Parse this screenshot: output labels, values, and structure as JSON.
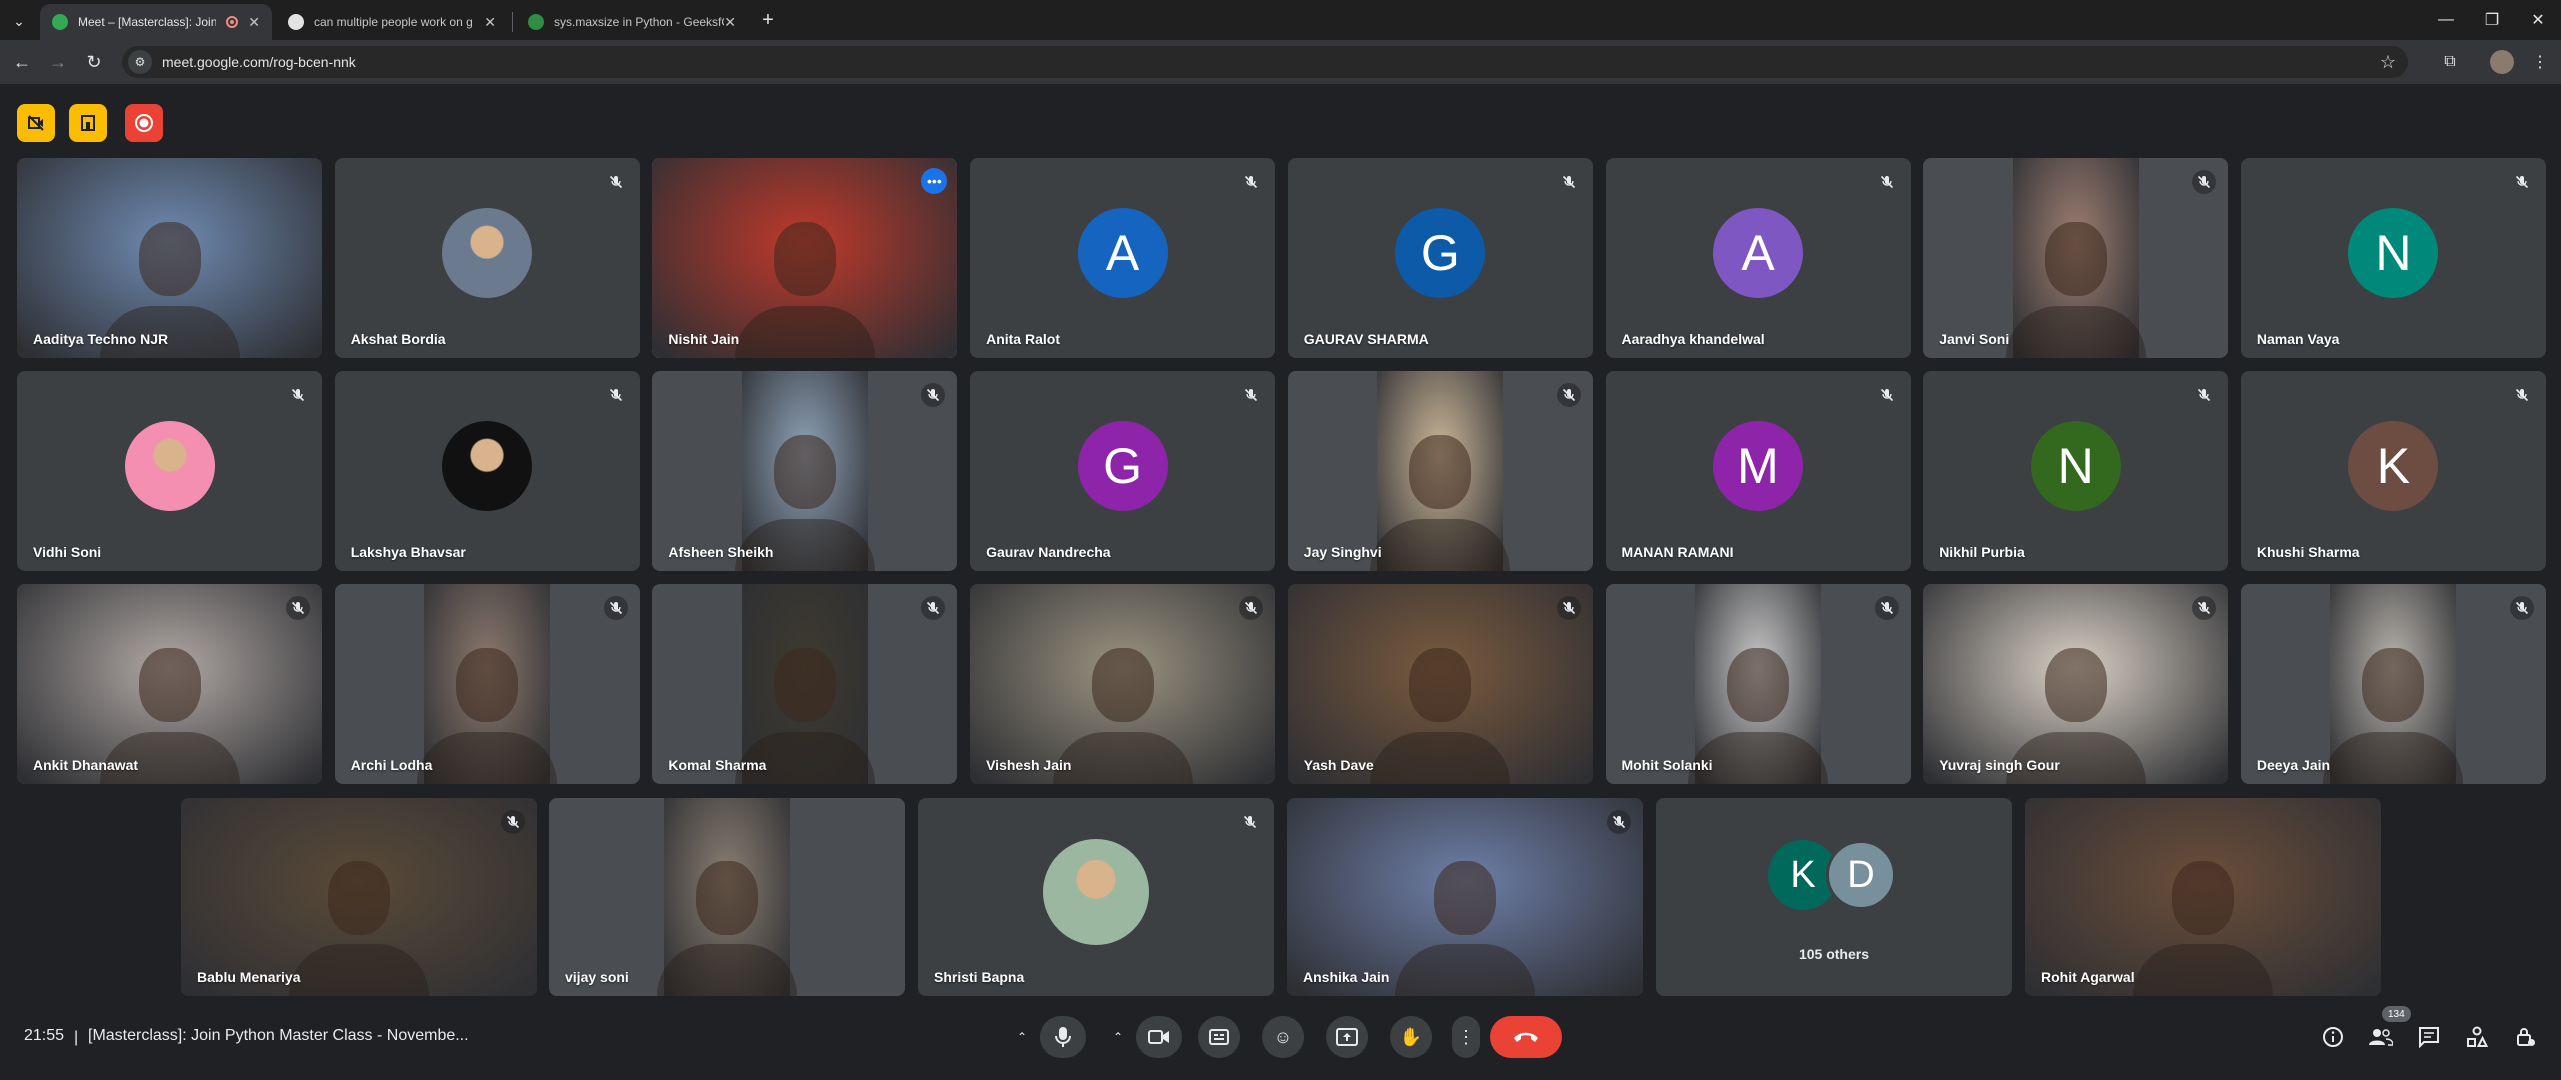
{
  "browser": {
    "tabs": [
      {
        "title": "Meet – [Masterclass]: Join P",
        "active": true,
        "favicon_color": "#34a853"
      },
      {
        "title": "can multiple people work on g",
        "active": false,
        "favicon_color": "#e3e3e3"
      },
      {
        "title": "sys.maxsize in Python - GeeksfG",
        "active": false,
        "favicon_color": "#2f8d46"
      }
    ],
    "url": "meet.google.com/rog-bcen-nnk"
  },
  "meet": {
    "colors": {
      "background": "#202124",
      "tile": "#3c4043",
      "speaker_ring": "#8ab4f8",
      "hangup": "#ea4335",
      "badge_yellow": "#fbbc04",
      "badge_red": "#ea4335"
    },
    "top_badges": [
      "no-video-warning-icon",
      "host-controls-icon",
      "recording-icon"
    ],
    "participants": [
      {
        "name": "Aaditya Techno NJR",
        "kind": "video",
        "muted": false,
        "video_tone": "#6f8bb2"
      },
      {
        "name": "Akshat Bordia",
        "kind": "photo",
        "muted": true,
        "avatar_color": "#6b7a8f"
      },
      {
        "name": "Nishit Jain",
        "kind": "video",
        "muted": false,
        "speaking": true,
        "video_tone": "#c0392b"
      },
      {
        "name": "Anita Ralot",
        "kind": "initial",
        "initial": "A",
        "muted": true,
        "avatar_color": "#1565c0"
      },
      {
        "name": "GAURAV SHARMA",
        "kind": "initial",
        "initial": "G",
        "muted": true,
        "avatar_color": "#0d5ba8"
      },
      {
        "name": "Aaradhya khandelwal",
        "kind": "initial",
        "initial": "A",
        "muted": true,
        "avatar_color": "#7e57c2"
      },
      {
        "name": "Janvi Soni",
        "kind": "video",
        "muted": true,
        "video_tone": "#9e7f72"
      },
      {
        "name": "Naman Vaya",
        "kind": "initial",
        "initial": "N",
        "muted": true,
        "avatar_color": "#00897b"
      },
      {
        "name": "Vidhi Soni",
        "kind": "photo",
        "muted": true,
        "avatar_color": "#f48fb1"
      },
      {
        "name": "Lakshya Bhavsar",
        "kind": "photo",
        "muted": true,
        "avatar_color": "#111111"
      },
      {
        "name": "Afsheen Sheikh",
        "kind": "video",
        "muted": true,
        "video_tone": "#8fa3b8"
      },
      {
        "name": "Gaurav Nandrecha",
        "kind": "initial",
        "initial": "G",
        "muted": true,
        "avatar_color": "#8e24aa"
      },
      {
        "name": "Jay Singhvi",
        "kind": "video",
        "muted": true,
        "video_tone": "#cdb899"
      },
      {
        "name": "MANAN RAMANI",
        "kind": "initial",
        "initial": "M",
        "muted": true,
        "avatar_color": "#8e24aa"
      },
      {
        "name": "Nikhil Purbia",
        "kind": "initial",
        "initial": "N",
        "muted": true,
        "avatar_color": "#33691e"
      },
      {
        "name": "Khushi Sharma",
        "kind": "initial",
        "initial": "K",
        "muted": true,
        "avatar_color": "#6d4c41"
      },
      {
        "name": "Ankit Dhanawat",
        "kind": "video",
        "muted": true,
        "video_tone": "#b0a8a4"
      },
      {
        "name": "Archi Lodha",
        "kind": "video",
        "muted": true,
        "video_tone": "#8d7a6e"
      },
      {
        "name": "Komal Sharma",
        "kind": "video",
        "muted": true,
        "video_tone": "#3e3a2f"
      },
      {
        "name": "Vishesh Jain",
        "kind": "video",
        "muted": true,
        "video_tone": "#9a9380"
      },
      {
        "name": "Yash Dave",
        "kind": "video",
        "muted": true,
        "video_tone": "#7a5a3e"
      },
      {
        "name": "Mohit Solanki",
        "kind": "video",
        "muted": true,
        "video_tone": "#c9c9c9"
      },
      {
        "name": "Yuvraj singh Gour",
        "kind": "video",
        "muted": true,
        "video_tone": "#d8d0c4"
      },
      {
        "name": "Deeya Jain",
        "kind": "video",
        "muted": true,
        "video_tone": "#b9b4ad"
      },
      {
        "name": "Bablu Menariya",
        "kind": "video",
        "muted": true,
        "video_tone": "#5a4a38"
      },
      {
        "name": "vijay soni",
        "kind": "video",
        "muted": false,
        "video_tone": "#8a7f72"
      },
      {
        "name": "Shristi Bapna",
        "kind": "photo",
        "muted": true,
        "avatar_color": "#9bb7a0"
      },
      {
        "name": "Anshika Jain",
        "kind": "video",
        "muted": true,
        "video_tone": "#6e7fa8"
      },
      {
        "name": "Rohit Agarwal",
        "kind": "video",
        "muted": false,
        "video_tone": "#6b4e3a"
      }
    ],
    "others": {
      "label": "105 others",
      "initials": [
        "K",
        "D"
      ],
      "colors": [
        "#00695c",
        "#78909c"
      ]
    },
    "bottom_bar": {
      "time": "21:55",
      "separator": "|",
      "meeting_title": "[Masterclass]: Join Python Master Class - Novembe...",
      "people_count": "134"
    }
  }
}
